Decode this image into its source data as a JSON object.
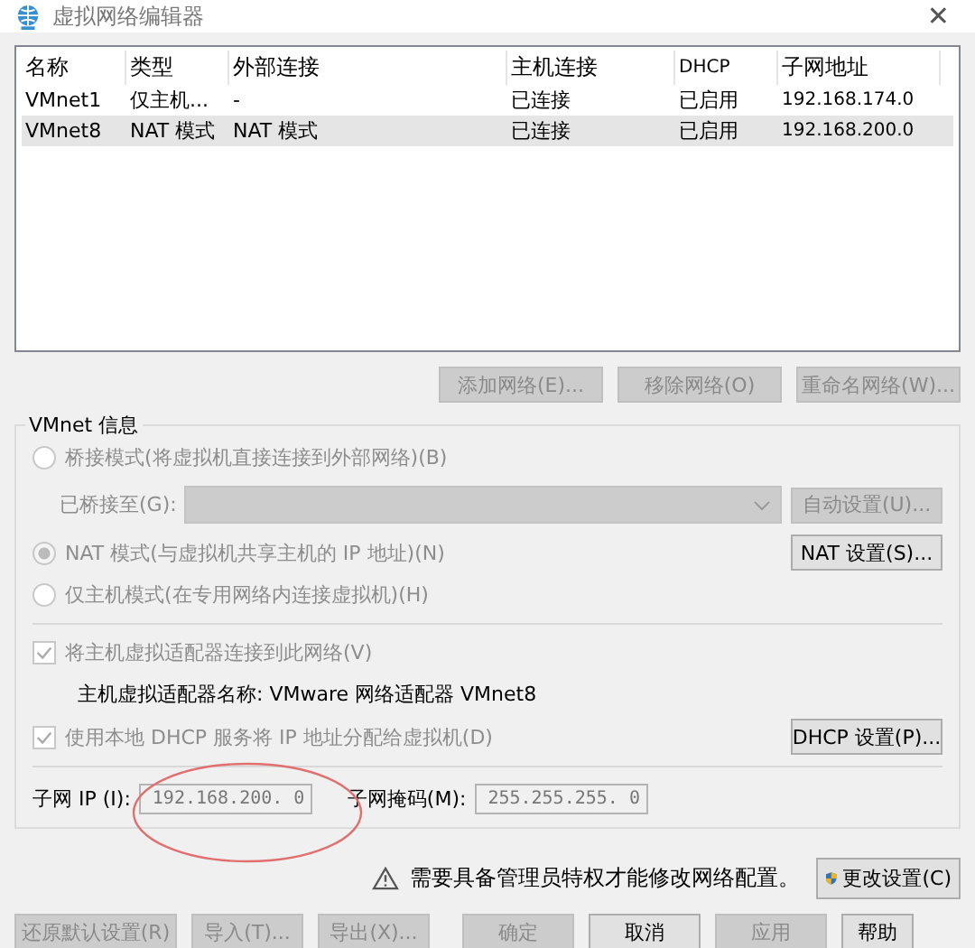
{
  "window": {
    "title": "虚拟网络编辑器",
    "close": "✕"
  },
  "table": {
    "columns": [
      "名称",
      "类型",
      "外部连接",
      "主机连接",
      "DHCP",
      "子网地址"
    ],
    "rows": [
      {
        "cells": [
          "VMnet1",
          "仅主机...",
          "-",
          "已连接",
          "已启用",
          "192.168.174.0"
        ],
        "selected": false
      },
      {
        "cells": [
          "VMnet8",
          "NAT 模式",
          "NAT 模式",
          "已连接",
          "已启用",
          "192.168.200.0"
        ],
        "selected": true
      }
    ]
  },
  "table_buttons": [
    {
      "label": "添加网络(E)...",
      "disabled": true
    },
    {
      "label": "移除网络(O)",
      "disabled": true
    },
    {
      "label": "重命名网络(W)...",
      "disabled": true
    }
  ],
  "vmnet_info": {
    "title": "VMnet 信息",
    "bridged": {
      "label": "桥接模式(将虚拟机直接连接到外部网络)(B)",
      "selected": false,
      "disabled": true
    },
    "bridged_to": {
      "label": "已桥接至(G):",
      "disabled": true
    },
    "auto_button": {
      "label": "自动设置(U)...",
      "disabled": true
    },
    "nat": {
      "label": "NAT 模式(与虚拟机共享主机的 IP 地址)(N)",
      "selected": true,
      "disabled": true
    },
    "nat_button": {
      "label": "NAT 设置(S)...",
      "disabled": false
    },
    "host_only": {
      "label": "仅主机模式(在专用网络内连接虚拟机)(H)",
      "selected": false,
      "disabled": true
    },
    "connect_adapter": {
      "label": "将主机虚拟适配器连接到此网络(V)",
      "checked": true,
      "disabled": true
    },
    "adapter_name": "主机虚拟适配器名称: VMware 网络适配器 VMnet8",
    "dhcp": {
      "label": "使用本地 DHCP 服务将 IP 地址分配给虚拟机(D)",
      "checked": true,
      "disabled": true
    },
    "dhcp_button": {
      "label": "DHCP 设置(P)...",
      "disabled": false
    },
    "subnet_ip": {
      "label": "子网 IP (I):",
      "value": "192.168.200. 0"
    },
    "subnet_mask": {
      "label": "子网掩码(M):",
      "value": "255.255.255. 0"
    },
    "highlight": {
      "kind": "ellipse"
    }
  },
  "notice": {
    "text": "需要具备管理员特权才能修改网络配置。",
    "button": "更改设置(C)"
  },
  "footer_buttons": [
    {
      "label": "还原默认设置(R)",
      "disabled": true
    },
    {
      "label": "导入(T)...",
      "disabled": true
    },
    {
      "label": "导出(X)...",
      "disabled": true
    },
    {
      "label": "确定",
      "disabled": true
    },
    {
      "label": "取消",
      "disabled": false
    },
    {
      "label": "应用",
      "disabled": true
    },
    {
      "label": "帮助",
      "disabled": false
    }
  ]
}
